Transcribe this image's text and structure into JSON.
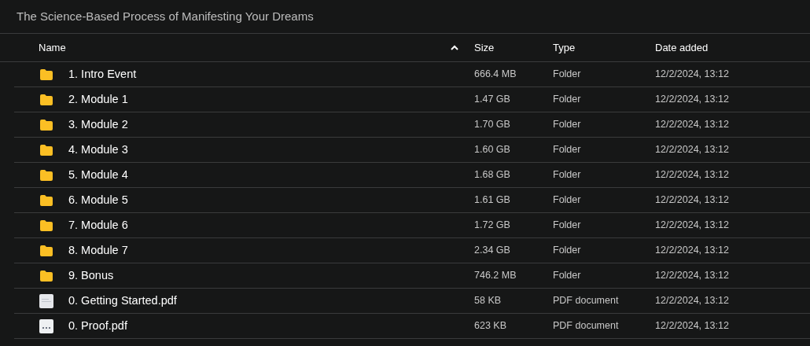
{
  "title": "The Science-Based Process of Manifesting Your Dreams",
  "columns": [
    {
      "label": "Name",
      "sort_ascending": true
    },
    {
      "label": "Size"
    },
    {
      "label": "Type"
    },
    {
      "label": "Date added"
    }
  ],
  "rows": [
    {
      "kind": "folder",
      "name": "1. Intro Event",
      "size": "666.4 MB",
      "type": "Folder",
      "date": "12/2/2024, 13:12"
    },
    {
      "kind": "folder",
      "name": "2. Module 1",
      "size": "1.47 GB",
      "type": "Folder",
      "date": "12/2/2024, 13:12"
    },
    {
      "kind": "folder",
      "name": "3. Module 2",
      "size": "1.70 GB",
      "type": "Folder",
      "date": "12/2/2024, 13:12"
    },
    {
      "kind": "folder",
      "name": "4. Module 3",
      "size": "1.60 GB",
      "type": "Folder",
      "date": "12/2/2024, 13:12"
    },
    {
      "kind": "folder",
      "name": "5. Module 4",
      "size": "1.68 GB",
      "type": "Folder",
      "date": "12/2/2024, 13:12"
    },
    {
      "kind": "folder",
      "name": "6. Module 5",
      "size": "1.61 GB",
      "type": "Folder",
      "date": "12/2/2024, 13:12"
    },
    {
      "kind": "folder",
      "name": "7. Module 6",
      "size": "1.72 GB",
      "type": "Folder",
      "date": "12/2/2024, 13:12"
    },
    {
      "kind": "folder",
      "name": "8. Module 7",
      "size": "2.34 GB",
      "type": "Folder",
      "date": "12/2/2024, 13:12"
    },
    {
      "kind": "folder",
      "name": "9. Bonus",
      "size": "746.2 MB",
      "type": "Folder",
      "date": "12/2/2024, 13:12"
    },
    {
      "kind": "document",
      "name": "0. Getting Started.pdf",
      "size": "58 KB",
      "type": "PDF document",
      "date": "12/2/2024, 13:12"
    },
    {
      "kind": "slides",
      "name": "0. Proof.pdf",
      "size": "623 KB",
      "type": "PDF document",
      "date": "12/2/2024, 13:12"
    }
  ]
}
